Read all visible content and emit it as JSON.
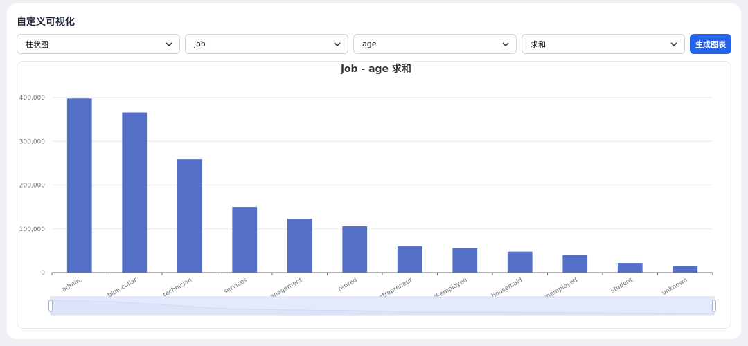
{
  "page": {
    "title": "自定义可视化"
  },
  "controls": {
    "chart_type": "柱状图",
    "x_field": "job",
    "y_field": "age",
    "aggregation": "求和",
    "generate_label": "生成图表"
  },
  "colors": {
    "accent": "#2563eb",
    "bar": "#5470c6",
    "zoom_fill": "#dbe6fb"
  },
  "chart_data": {
    "type": "bar",
    "title": "job - age 求和",
    "xlabel": "",
    "ylabel": "",
    "categories": [
      "admin.",
      "blue-collar",
      "technician",
      "services",
      "management",
      "retired",
      "entrepreneur",
      "self-employed",
      "housemaid",
      "unemployed",
      "student",
      "unknown"
    ],
    "values": [
      398000,
      366000,
      259000,
      150000,
      123000,
      106000,
      60000,
      56000,
      48000,
      40000,
      22000,
      15000
    ],
    "ylim": [
      0,
      400000
    ],
    "yticks": [
      0,
      100000,
      200000,
      300000,
      400000
    ],
    "ytick_labels": [
      "0",
      "100,000",
      "200,000",
      "300,000",
      "400,000"
    ],
    "grid": true,
    "data_zoom": {
      "start": 0,
      "end": 100
    }
  }
}
